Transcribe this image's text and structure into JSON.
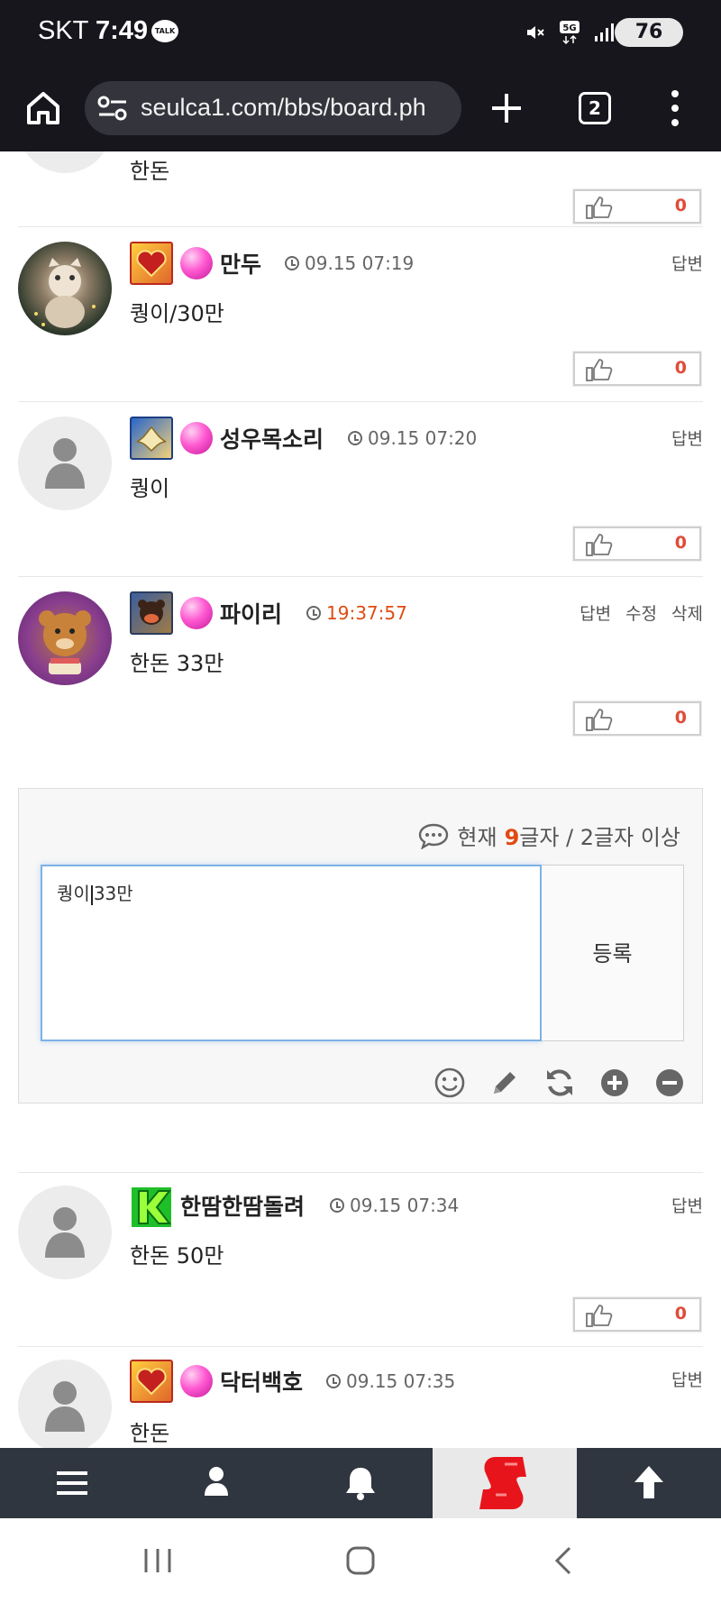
{
  "status_bar": {
    "carrier": "SKT",
    "time": "7:49",
    "talk_label": "TALK",
    "network": "5G",
    "battery": "76"
  },
  "browser": {
    "url": "seulca1.com/bbs/board.ph",
    "tab_count": "2"
  },
  "comments_top": [
    {
      "id": "c0",
      "nick": "",
      "time": "",
      "body": "한돈",
      "actions": [],
      "likes": "0"
    },
    {
      "id": "c1",
      "nick": "만두",
      "time": "09.15 07:19",
      "body": "퀑이/30만",
      "actions": [
        "답변"
      ],
      "likes": "0"
    },
    {
      "id": "c2",
      "nick": "성우목소리",
      "time": "09.15 07:20",
      "body": "퀑이",
      "actions": [
        "답변"
      ],
      "likes": "0"
    },
    {
      "id": "c3",
      "nick": "파이리",
      "time": "19:37:57",
      "body": "한돈 33만",
      "actions": [
        "답변",
        "수정",
        "삭제"
      ],
      "likes": "0"
    }
  ],
  "editor": {
    "counter_prefix": "현재",
    "counter_value": "9",
    "counter_suffix": "글자 / 2글자 이상",
    "text_before_caret": "퀑이",
    "text_after_caret": "33만",
    "submit_label": "등록"
  },
  "comments_bottom": [
    {
      "id": "c4",
      "nick": "한땀한땀돌려",
      "time": "09.15 07:34",
      "body": "한돈 50만",
      "actions": [
        "답변"
      ],
      "likes": "0"
    },
    {
      "id": "c5",
      "nick": "닥터백호",
      "time": "09.15 07:35",
      "body": "한돈",
      "actions": [
        "답변"
      ],
      "likes": ""
    }
  ],
  "colors": {
    "accent": "#e04b12",
    "like_count": "#e04b37",
    "bottom_nav": "#2f3640"
  }
}
